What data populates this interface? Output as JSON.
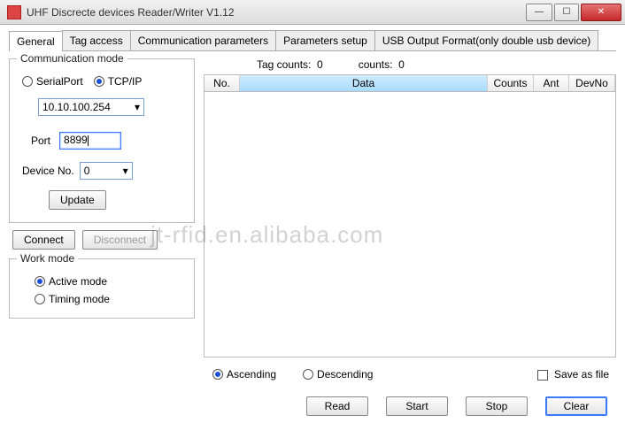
{
  "window": {
    "title": "UHF Discrecte devices Reader/Writer V1.12"
  },
  "tabs": {
    "general": "General",
    "tag_access": "Tag access",
    "comm_params": "Communication parameters",
    "param_setup": "Parameters setup",
    "usb_output": "USB Output Format(only double usb device)"
  },
  "comm_mode": {
    "legend": "Communication mode",
    "serial_label": "SerialPort",
    "tcpip_label": "TCP/IP",
    "ip_value": "10.10.100.254",
    "port_label": "Port",
    "port_value": "8899",
    "device_no_label": "Device No.",
    "device_no_value": "0",
    "update_btn": "Update"
  },
  "connect_btn": "Connect",
  "disconnect_btn": "Disconnect",
  "work_mode": {
    "legend": "Work mode",
    "active_label": "Active mode",
    "timing_label": "Timing mode"
  },
  "right": {
    "tag_counts_label": "Tag counts:",
    "tag_counts_value": "0",
    "counts_label": "counts:",
    "counts_value": "0",
    "th_no": "No.",
    "th_data": "Data",
    "th_counts": "Counts",
    "th_ant": "Ant",
    "th_devno": "DevNo",
    "ascending": "Ascending",
    "descending": "Descending",
    "save_as_file": "Save as file",
    "read_btn": "Read",
    "start_btn": "Start",
    "stop_btn": "Stop",
    "clear_btn": "Clear"
  },
  "watermark": "jt-rfid.en.alibaba.com"
}
